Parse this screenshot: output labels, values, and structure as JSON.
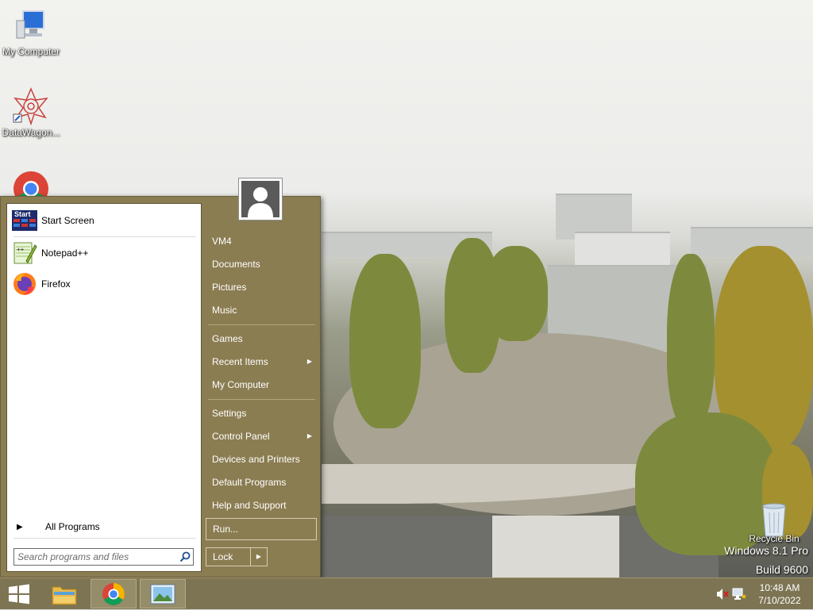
{
  "desktop": {
    "icons": [
      {
        "label": "My Computer",
        "icon": "computer-icon"
      },
      {
        "label": "DataWagon...",
        "icon": "datawagon-icon"
      },
      {
        "label": "",
        "icon": "chrome-icon"
      },
      {
        "label": "Recycle Bin",
        "icon": "recycle-bin-icon"
      }
    ],
    "watermark": {
      "line1": "Windows 8.1 Pro",
      "line2": "Build 9600"
    }
  },
  "start_menu": {
    "programs": [
      {
        "label": "Start Screen",
        "icon": "start-screen-icon",
        "icon_text": "Start"
      },
      {
        "label": "Notepad++",
        "icon": "notepadpp-icon"
      },
      {
        "label": "Firefox",
        "icon": "firefox-icon"
      }
    ],
    "all_programs": "All Programs",
    "search_placeholder": "Search programs and files",
    "right_items": [
      {
        "label": "VM4"
      },
      {
        "label": "Documents"
      },
      {
        "label": "Pictures"
      },
      {
        "label": "Music"
      },
      {
        "label": "Games"
      },
      {
        "label": "Recent Items",
        "submenu": true
      },
      {
        "label": "My Computer"
      },
      {
        "label": "Settings"
      },
      {
        "label": "Control Panel",
        "submenu": true
      },
      {
        "label": "Devices and Printers"
      },
      {
        "label": "Default Programs"
      },
      {
        "label": "Help and Support"
      },
      {
        "label": "Run..."
      }
    ],
    "lock": "Lock",
    "lock_arrow": "▶",
    "submenu_arrow": "▶"
  },
  "taskbar": {
    "apps": [
      {
        "name": "file-explorer",
        "icon": "folder-icon"
      },
      {
        "name": "chrome",
        "icon": "chrome-icon"
      },
      {
        "name": "photos",
        "icon": "picture-icon"
      }
    ],
    "clock": {
      "time": "10:48 AM",
      "date": "7/10/2022"
    }
  },
  "colors": {
    "menu": "#8b7d52",
    "taskbar": "#7d7454"
  }
}
